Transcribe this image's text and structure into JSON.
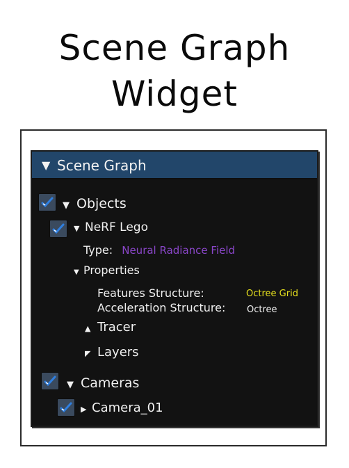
{
  "page": {
    "title_line_1": "Scene Graph",
    "title_line_2": "Widget"
  },
  "widget": {
    "header_label": "Scene Graph",
    "header_icon": "triangle-down-icon",
    "colors": {
      "header_bg": "#22466a",
      "panel_bg": "#121212",
      "checkbox_bg": "#3a4a5e",
      "check_mark": "#2f7fe0",
      "purple_value": "#8a46c9",
      "yellow_value": "#e6e01e"
    },
    "tree": {
      "objects": {
        "label": "Objects",
        "checked": true,
        "expanded": true
      },
      "nerf_lego": {
        "label": "NeRF Lego",
        "checked": true,
        "expanded": true,
        "type_key": "Type:",
        "type_value": "Neural Radiance Field",
        "properties": {
          "label": "Properties",
          "expanded": true,
          "features_key": "Features Structure:",
          "features_value": "Octree Grid",
          "accel_key": "Acceleration Structure:",
          "accel_value": "Octree"
        },
        "tracer": {
          "label": "Tracer",
          "expanded": false
        },
        "layers": {
          "label": "Layers",
          "expanded": false
        }
      },
      "cameras": {
        "label": "Cameras",
        "checked": true,
        "expanded": true
      },
      "camera_01": {
        "label": "Camera_01",
        "checked": true,
        "expanded": false
      }
    }
  }
}
